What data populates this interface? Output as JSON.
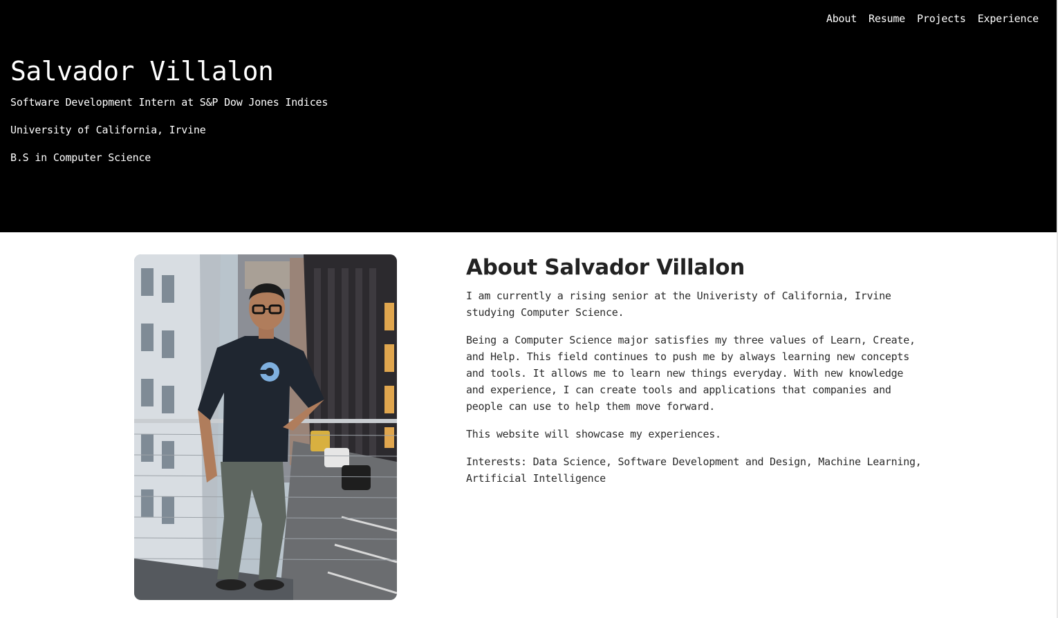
{
  "nav": {
    "items": [
      {
        "label": "About"
      },
      {
        "label": "Resume"
      },
      {
        "label": "Projects"
      },
      {
        "label": "Experience"
      }
    ]
  },
  "hero": {
    "name": "Salvador Villalon",
    "role": "Software Development Intern at S&P Dow Jones Indices",
    "school": "University of California, Irvine",
    "degree": "B.S in Computer Science"
  },
  "about": {
    "title": "About Salvador Villalon",
    "paragraphs": [
      "I am currently a rising senior at the Univeristy of California, Irvine studying Computer Science.",
      "Being a Computer Science major satisfies my three values of Learn, Create, and Help. This field continues to push me by always learning new concepts and tools. It allows me to learn new things everyday. With new knowledge and experience, I can create tools and applications that companies and people can use to help them move forward.",
      "This website will showcase my experiences.",
      "Interests: Data Science, Software Development and Design, Machine Learning, Artificial Intelligence"
    ],
    "photo_icon": "profile-photo"
  },
  "colors": {
    "hero_bg": "#000000",
    "hero_text": "#ffffff",
    "body_bg": "#ffffff",
    "heading": "#222222",
    "text": "#2a2a2a"
  }
}
